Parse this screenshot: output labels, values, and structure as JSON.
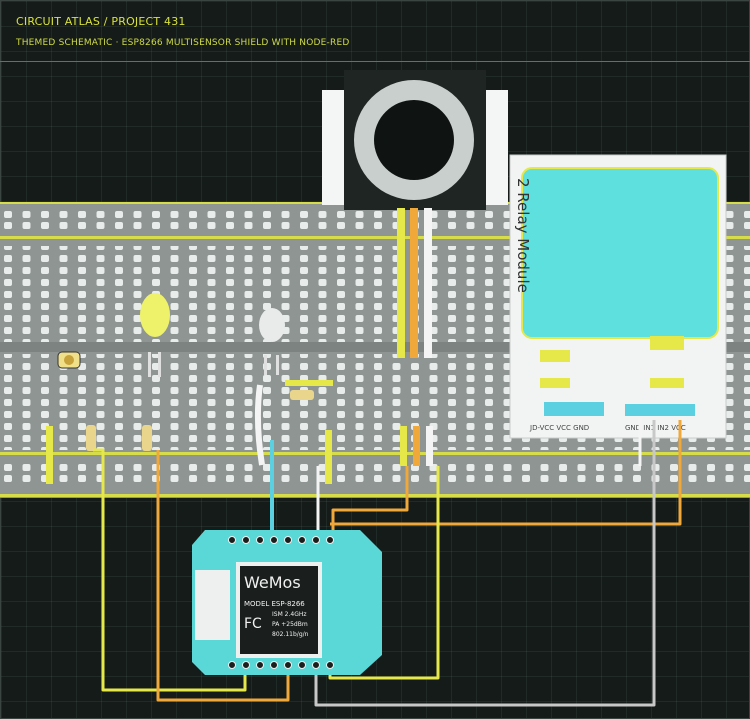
{
  "header": {
    "title": "CIRCUIT ATLAS / PROJECT 431",
    "subtitle": "THEMED SCHEMATIC · ESP8266 MULTISENSOR SHIELD WITH NODE-RED"
  },
  "relay_module": {
    "label": "2 Relay Module",
    "header_left": "JD-VCC VCC GND",
    "header_right": "GND IN1 IN2 VCC"
  },
  "wemos": {
    "logo": "WeMos",
    "model": "MODEL ESP-8266",
    "spec_1": "ISM 2.4GHz",
    "spec_2": "PA +25dBm",
    "spec_3": "802.11b/g/n",
    "fc": "FC"
  },
  "colors": {
    "background": "#151b19",
    "breadboard": "#8e9593",
    "board": "#5ad8d8",
    "accent": "#d8e23a",
    "wire_yellow": "#e6e84a",
    "wire_orange": "#f0a83a",
    "wire_gray": "#c8c8c8",
    "wire_cyan": "#5ad0e0"
  }
}
